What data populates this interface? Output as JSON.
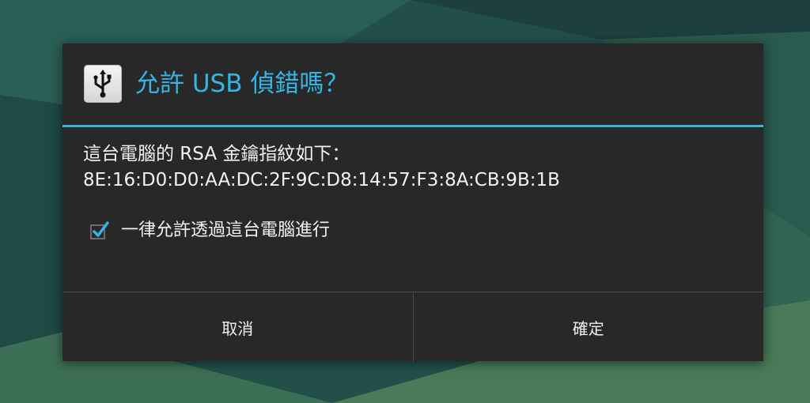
{
  "dialog": {
    "icon": "usb-icon",
    "title": "允許 USB 偵錯嗎？",
    "message_line1": "這台電腦的 RSA 金鑰指紋如下：",
    "message_line2": "8E:16:D0:D0:AA:DC:2F:9C:D8:14:57:F3:8A:CB:9B:1B",
    "checkbox": {
      "label": "一律允許透過這台電腦進行",
      "checked": true,
      "icon": "checkmark-icon"
    },
    "buttons": {
      "cancel_label": "取消",
      "ok_label": "確定"
    }
  },
  "colors": {
    "accent": "#33b5e5",
    "dialog_background": "#282828",
    "text": "#f2f2f2",
    "divider": "#4a4a4a"
  }
}
